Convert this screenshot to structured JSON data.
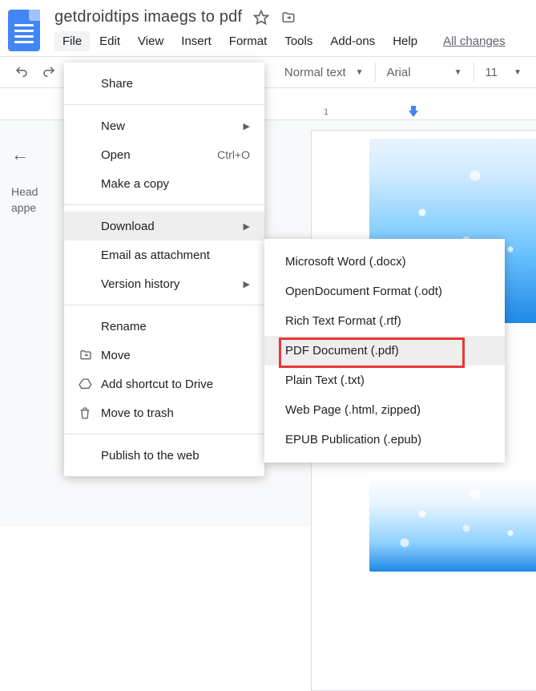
{
  "doc_title": "getdroidtips imaegs to pdf",
  "menubar": {
    "file": "File",
    "edit": "Edit",
    "view": "View",
    "insert": "Insert",
    "format": "Format",
    "tools": "Tools",
    "addons": "Add-ons",
    "help": "Help",
    "all_changes": "All changes"
  },
  "toolbar": {
    "style_label": "Normal text",
    "font_label": "Arial",
    "font_size": "11"
  },
  "ruler": {
    "tick1": "1",
    "tick2": ""
  },
  "outline": {
    "text_line1": "Head",
    "text_line2": "appe"
  },
  "file_menu": {
    "share": "Share",
    "new": "New",
    "open": "Open",
    "open_shortcut": "Ctrl+O",
    "make_copy": "Make a copy",
    "download": "Download",
    "email_attachment": "Email as attachment",
    "version_history": "Version history",
    "rename": "Rename",
    "move": "Move",
    "add_shortcut": "Add shortcut to Drive",
    "move_trash": "Move to trash",
    "publish_web": "Publish to the web"
  },
  "download_submenu": {
    "docx": "Microsoft Word (.docx)",
    "odt": "OpenDocument Format (.odt)",
    "rtf": "Rich Text Format (.rtf)",
    "pdf": "PDF Document (.pdf)",
    "txt": "Plain Text (.txt)",
    "html": "Web Page (.html, zipped)",
    "epub": "EPUB Publication (.epub)"
  }
}
